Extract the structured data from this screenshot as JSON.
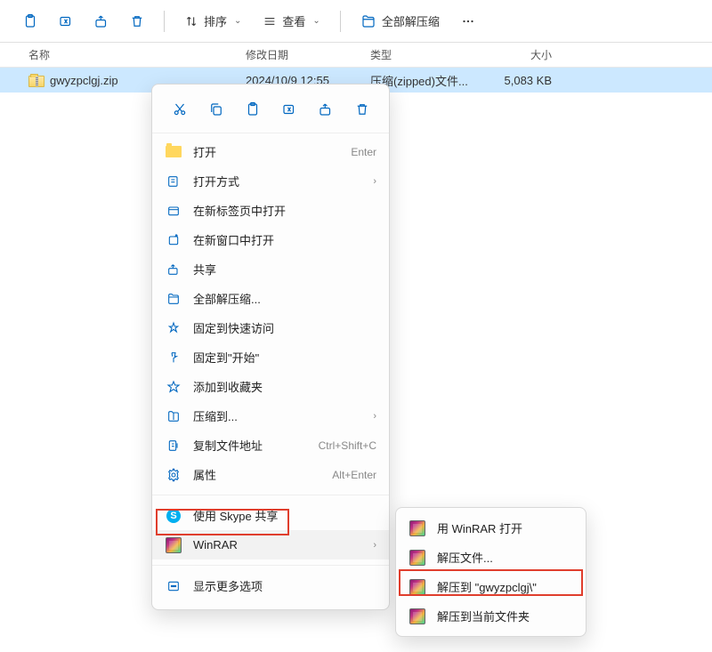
{
  "toolbar": {
    "sort_label": "排序",
    "view_label": "查看",
    "extract_all_label": "全部解压缩"
  },
  "columns": {
    "name": "名称",
    "modified": "修改日期",
    "type": "类型",
    "size": "大小"
  },
  "file": {
    "name": "gwyzpclgj.zip",
    "modified": "2024/10/9 12:55",
    "type": "压缩(zipped)文件...",
    "size": "5,083 KB"
  },
  "menu_actions": {
    "cut": "剪切",
    "copy": "复制",
    "paste": "粘贴",
    "rename": "重命名",
    "share": "分享",
    "delete": "删除"
  },
  "context_menu": {
    "open": "打开",
    "open_shortcut": "Enter",
    "open_with": "打开方式",
    "open_new_tab": "在新标签页中打开",
    "open_new_window": "在新窗口中打开",
    "share": "共享",
    "extract_all": "全部解压缩...",
    "pin_quick_access": "固定到快速访问",
    "pin_start": "固定到\"开始\"",
    "add_favorites": "添加到收藏夹",
    "compress_to": "压缩到...",
    "copy_path": "复制文件地址",
    "copy_path_shortcut": "Ctrl+Shift+C",
    "properties": "属性",
    "properties_shortcut": "Alt+Enter",
    "skype_share": "使用 Skype 共享",
    "winrar": "WinRAR",
    "show_more": "显示更多选项"
  },
  "submenu": {
    "open_with_winrar": "用 WinRAR 打开",
    "extract_files": "解压文件...",
    "extract_to_folder": "解压到 \"gwyzpclgj\\\"",
    "extract_here": "解压到当前文件夹"
  }
}
